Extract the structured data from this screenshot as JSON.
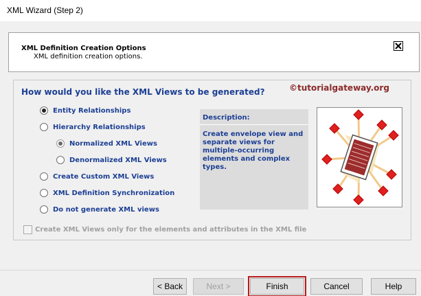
{
  "window": {
    "title": "XML Wizard (Step 2)"
  },
  "header": {
    "title": "XML Definition Creation Options",
    "subtitle": "XML definition creation options.",
    "close_icon": "close-box-icon"
  },
  "main": {
    "question": "How would you like the XML Views to be generated?",
    "watermark": "©tutorialgateway.org",
    "options": [
      {
        "label": "Entity Relationships",
        "checked": true
      },
      {
        "label": "Hierarchy Relationships",
        "checked": false
      },
      {
        "label": "Normalized XML Views",
        "checked": true,
        "disabled": true
      },
      {
        "label": "Denormalized XML Views",
        "checked": false,
        "disabled": true
      },
      {
        "label": "Create Custom XML Views",
        "checked": false
      },
      {
        "label": "XML Definition Synchronization",
        "checked": false
      },
      {
        "label": "Do not generate XML views",
        "checked": false
      }
    ],
    "description": {
      "heading": "Description:",
      "text": "Create envelope view and\nseparate views for\nmultiple-occurring\nelements and complex\ntypes."
    },
    "illustration_icon": "document-network-icon",
    "checkbox": {
      "label": "Create XML Views only for the elements and attributes in the XML file",
      "checked": false,
      "disabled": true
    }
  },
  "footer": {
    "back_label": "< Back",
    "next_label": "Next >",
    "finish_label": "Finish",
    "cancel_label": "Cancel",
    "help_label": "Help"
  },
  "colors": {
    "label_blue": "#1c3f94",
    "watermark_red": "#8b2a2a",
    "highlight_red": "#b71c1c"
  }
}
